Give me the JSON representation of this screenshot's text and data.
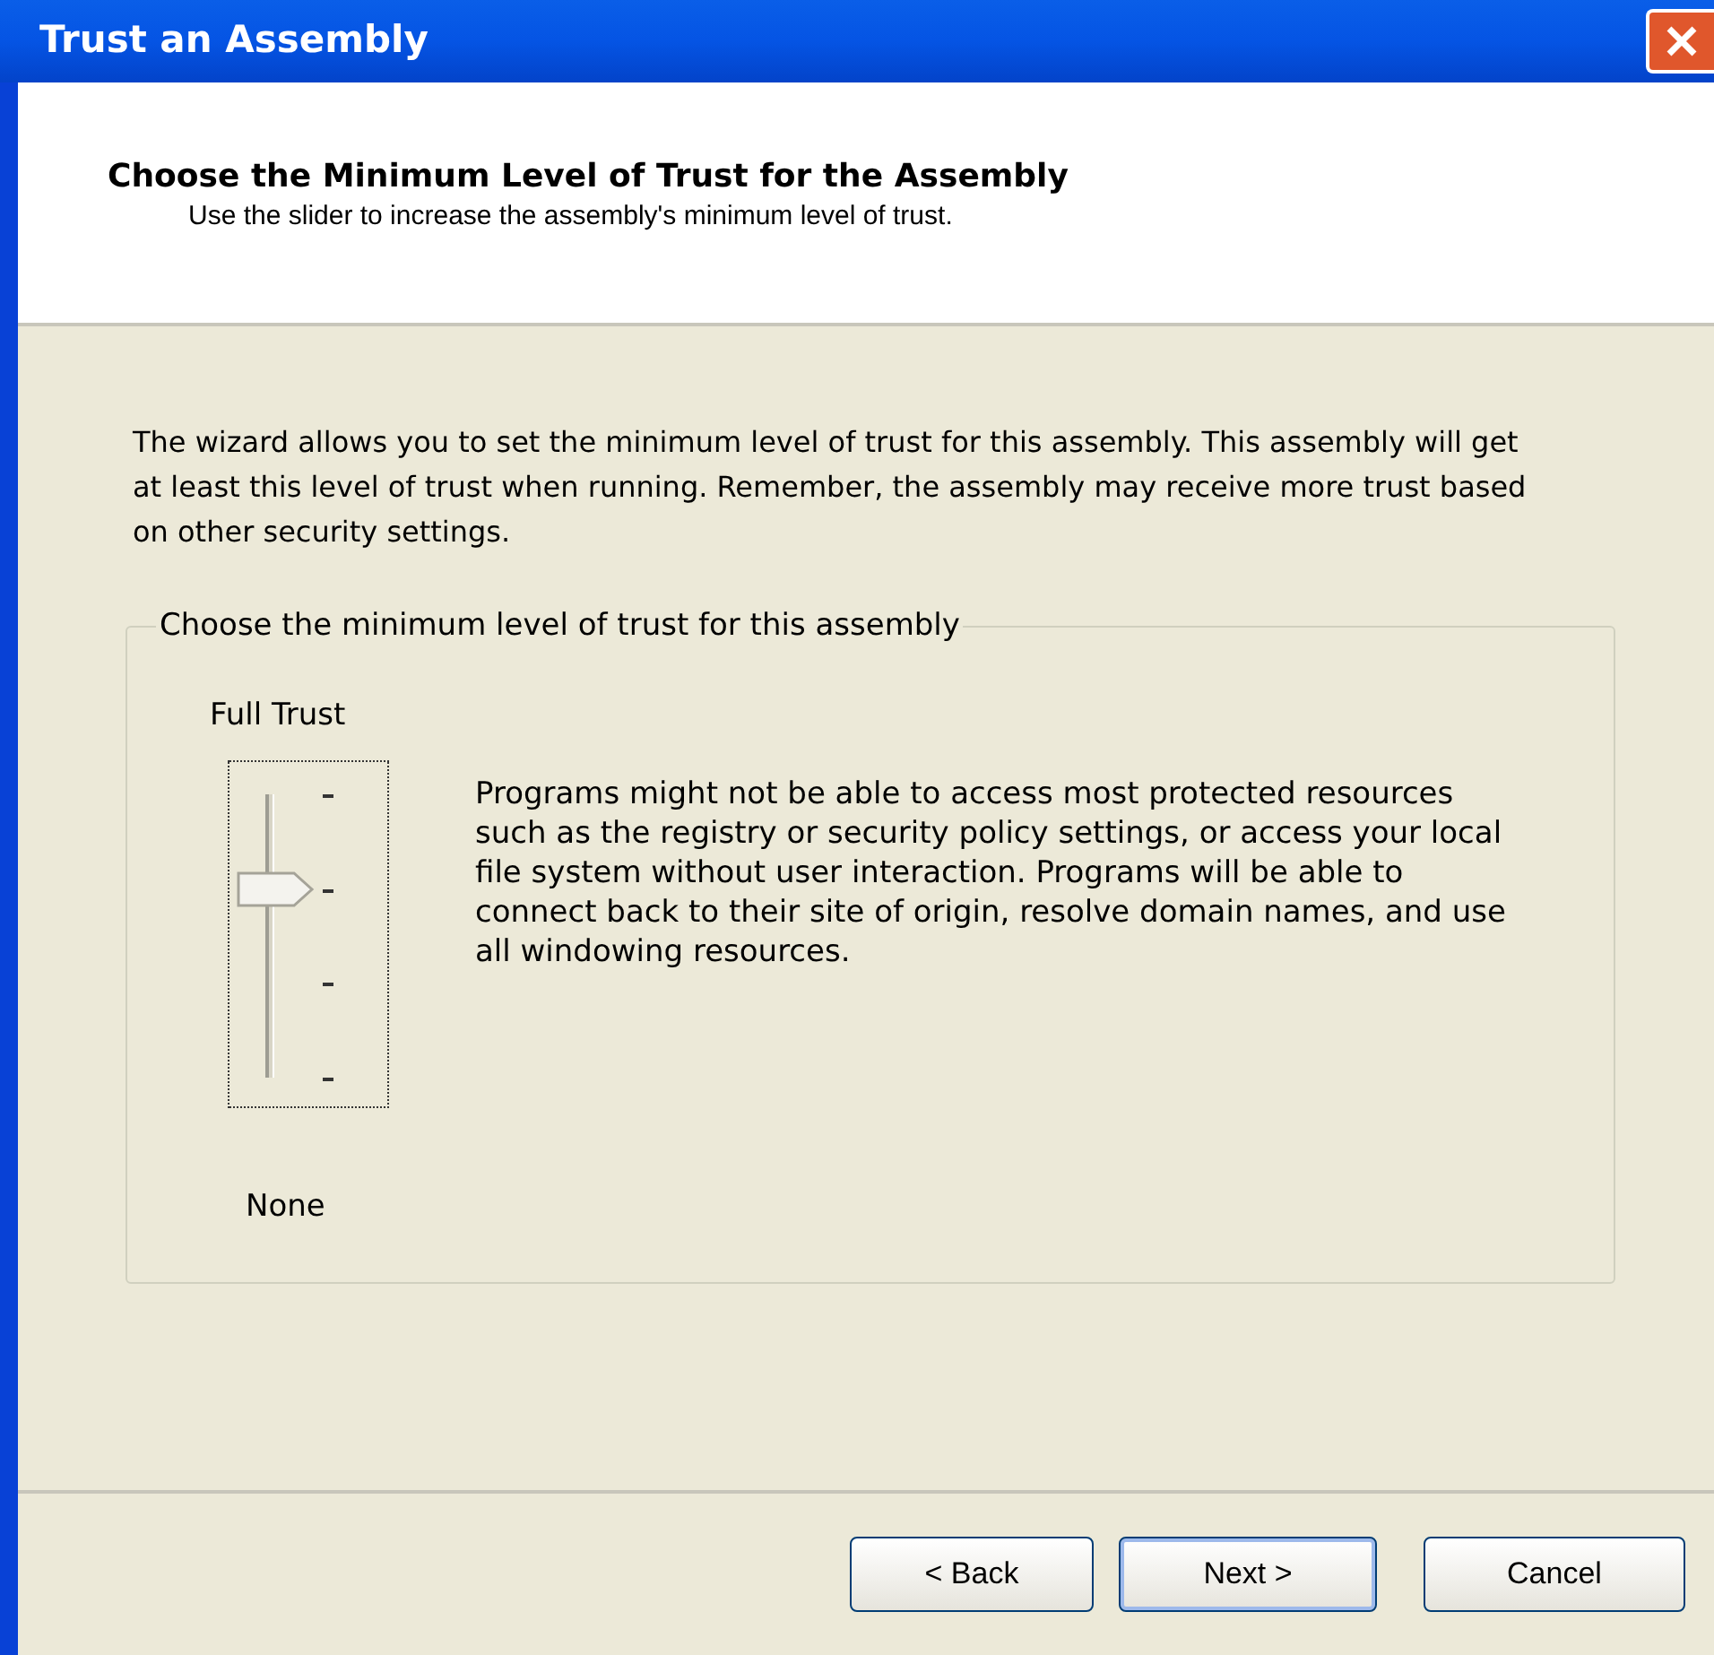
{
  "window": {
    "title": "Trust an Assembly"
  },
  "header": {
    "title": "Choose the Minimum Level of Trust for the Assembly",
    "subtitle": "Use the slider to increase the assembly's minimum level of trust."
  },
  "intro": "The wizard allows you to set the minimum level of trust for this assembly.  This assembly will get at least this level of trust when running.  Remember, the assembly may receive more trust based on other security settings.",
  "group": {
    "title": "Choose the minimum level of trust for this assembly",
    "top_label": "Full Trust",
    "bottom_label": "None",
    "slider": {
      "level": 0.667,
      "focused": true
    },
    "description": "Programs might not be able to access most protected resources such as the registry or security policy settings, or access your local file system without user interaction. Programs will be able to connect back to their site of origin, resolve domain names, and use all windowing resources."
  },
  "buttons": [
    {
      "label": "< Back",
      "default": false
    },
    {
      "label": "Next >",
      "default": true
    },
    {
      "label": "Cancel",
      "default": false
    }
  ]
}
